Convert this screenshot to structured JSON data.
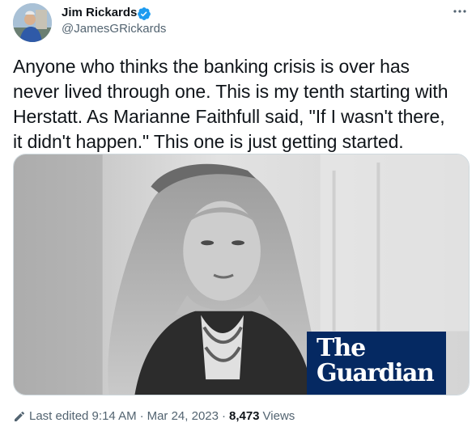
{
  "author": {
    "name": "Jim Rickards",
    "handle": "@JamesGRickards",
    "verified": true
  },
  "tweet": {
    "lines": [
      "Anyone who thinks the banking crisis is over has",
      "never lived through one. This is my tenth starting with",
      "Herstatt. As Marianne Faithfull said, \"If I wasn't there,",
      "it didn't happen.\" This one is just getting started."
    ]
  },
  "media": {
    "logo_line1": "The",
    "logo_line2": "Guardian"
  },
  "meta": {
    "edited": "Last edited 9:14 AM",
    "date": "Mar 24, 2023",
    "views_count": "8,473",
    "views_label": "Views",
    "separator": "·"
  },
  "colors": {
    "text": "#0f1419",
    "secondary": "#536471",
    "verified": "#1d9bf0",
    "guardian": "#052962"
  },
  "icons": {
    "more": "more-icon",
    "verified": "verified-badge-icon",
    "edit": "edit-pencil-icon"
  }
}
